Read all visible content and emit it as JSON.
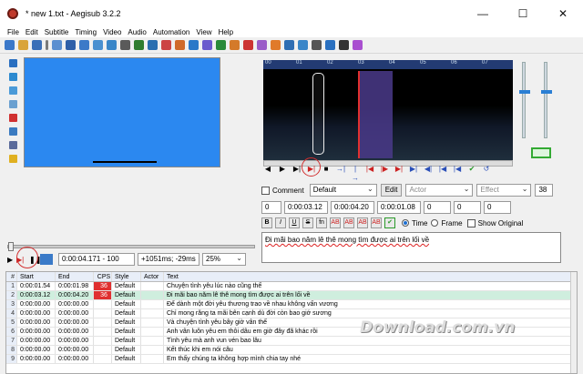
{
  "window": {
    "title": "* new 1.txt - Aegisub 3.2.2",
    "minimize": "—",
    "maximize": "☐",
    "close": "✕"
  },
  "menu": [
    "File",
    "Edit",
    "Subtitle",
    "Timing",
    "Video",
    "Audio",
    "Automation",
    "View",
    "Help"
  ],
  "audio_ruler": [
    "00",
    "01",
    "02",
    "03",
    "04",
    "05",
    "06",
    "07"
  ],
  "playbar": [
    "◀",
    "▶",
    "▶|",
    "▶|",
    "■",
    "→|",
    "|→",
    "|◀",
    "|▶",
    "▶|",
    "▶|",
    "◀|",
    "|◀",
    "|◀",
    "✔",
    "↺"
  ],
  "edit": {
    "comment_label": "Comment",
    "style_value": "Default",
    "edit_button": "Edit",
    "actor_placeholder": "Actor",
    "effect_placeholder": "Effect",
    "margin_value": "38",
    "layer_value": "0",
    "start_time": "0:00:03.12",
    "end_time": "0:00:04.20",
    "duration": "0:00:01.08",
    "margin_l": "0",
    "margin_r": "0",
    "margin_v": "0",
    "format_buttons": [
      "B",
      "I",
      "U",
      "S",
      "fn",
      "AB",
      "AB",
      "AB",
      "AB"
    ],
    "time_label": "Time",
    "frame_label": "Frame",
    "show_original_label": "Show Original",
    "text": "Đi mãi bao năm lê thê mong tìm được ai trên lối về"
  },
  "video_controls": {
    "time": "0:00:04.171 - 100",
    "offset": "+1051ms; -29ms",
    "zoom": "25%"
  },
  "grid": {
    "headers": [
      "#",
      "Start",
      "End",
      "CPS",
      "Style",
      "Actor",
      "Text"
    ],
    "rows": [
      {
        "n": "1",
        "start": "0:00:01.54",
        "end": "0:00:01.98",
        "cps": "36",
        "style": "Default",
        "actor": "",
        "text": "Chuyện tình yêu lúc nào cũng thế"
      },
      {
        "n": "2",
        "start": "0:00:03.12",
        "end": "0:00:04.20",
        "cps": "36",
        "style": "Default",
        "actor": "",
        "text": "Đi mãi bao năm lê thê mong tìm được ai trên lối về"
      },
      {
        "n": "3",
        "start": "0:00:00.00",
        "end": "0:00:00.00",
        "cps": "",
        "style": "Default",
        "actor": "",
        "text": "Để dành một đời yêu thương trao về nhau không vấn vương"
      },
      {
        "n": "4",
        "start": "0:00:00.00",
        "end": "0:00:00.00",
        "cps": "",
        "style": "Default",
        "actor": "",
        "text": "Chỉ mong rằng ta mãi bên cạnh dù đời còn bao giớ sương"
      },
      {
        "n": "5",
        "start": "0:00:00.00",
        "end": "0:00:00.00",
        "cps": "",
        "style": "Default",
        "actor": "",
        "text": "Và chuyện tình yêu bây giờ vẫn thế"
      },
      {
        "n": "6",
        "start": "0:00:00.00",
        "end": "0:00:00.00",
        "cps": "",
        "style": "Default",
        "actor": "",
        "text": "Anh vẫn luôn yêu em thôi dẫu em giờ đây đã khác rồi"
      },
      {
        "n": "7",
        "start": "0:00:00.00",
        "end": "0:00:00.00",
        "cps": "",
        "style": "Default",
        "actor": "",
        "text": "Tình yêu mà anh vun vén bao lâu"
      },
      {
        "n": "8",
        "start": "0:00:00.00",
        "end": "0:00:00.00",
        "cps": "",
        "style": "Default",
        "actor": "",
        "text": "Kết thúc khi em nói câu"
      },
      {
        "n": "9",
        "start": "0:00:00.00",
        "end": "0:00:00.00",
        "cps": "",
        "style": "Default",
        "actor": "",
        "text": "Em thấy chúng ta không hợp mình chia tay nhé"
      }
    ]
  },
  "watermark": "Download.com.vn",
  "colors": {
    "video": "#2b88f0",
    "selection": "#4a3a8a",
    "cps_warn": "#e03030",
    "active_row": "#cfeede"
  }
}
